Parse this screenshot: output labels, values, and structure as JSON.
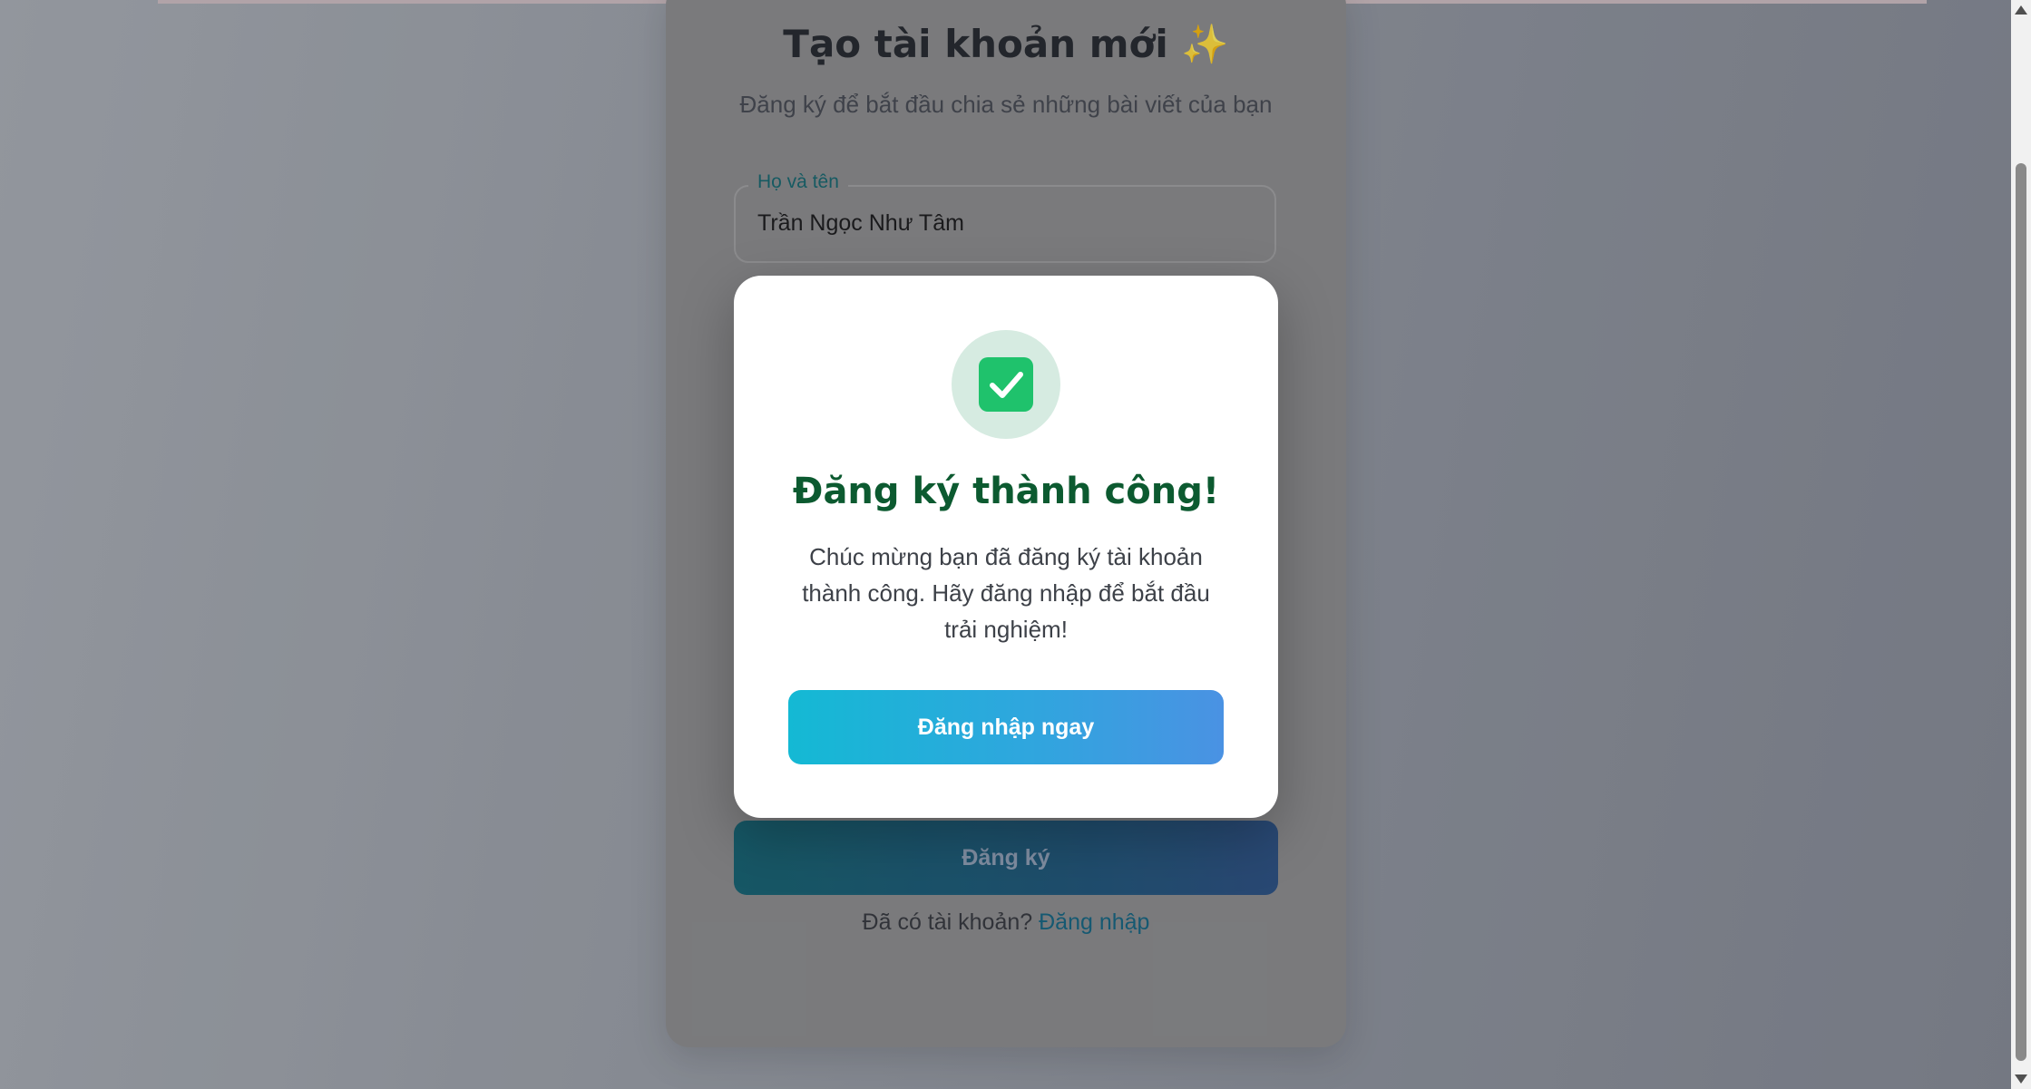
{
  "register_card": {
    "title": "Tạo tài khoản mới",
    "title_emoji": "✨",
    "subtitle": "Đăng ký để bắt đầu chia sẻ những bài viết của bạn",
    "full_name_field": {
      "label": "Họ và tên",
      "value": "Trần Ngọc Như Tâm"
    },
    "register_button_label": "Đăng ký",
    "have_account_text": "Đã có tài khoản?",
    "login_link_label": "Đăng nhập"
  },
  "success_modal": {
    "icon": "check-mark-icon",
    "title": "Đăng ký thành công!",
    "message": "Chúc mừng bạn đã đăng ký tài khoản thành công. Hãy đăng nhập để bắt đầu trải nghiệm!",
    "login_button_label": "Đăng nhập ngay"
  },
  "colors": {
    "success_green": "#1fc26c",
    "title_green": "#0c5a30",
    "button_gradient_start": "#14b9d4",
    "button_gradient_end": "#4a92e3",
    "link_teal": "#0a5d79"
  }
}
